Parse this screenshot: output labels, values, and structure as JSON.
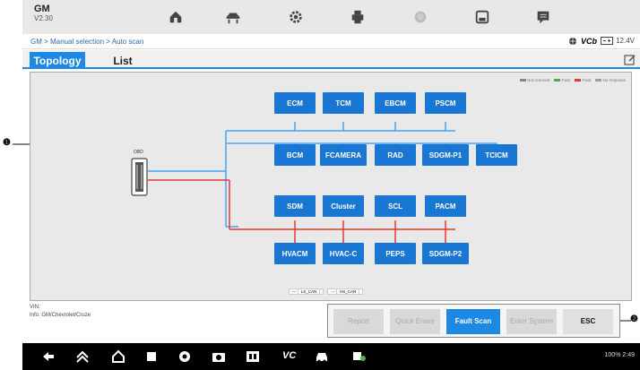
{
  "header": {
    "brand_name": "GM",
    "version": "V2.30",
    "tools": [
      "home-icon",
      "vehicle-lift-icon",
      "gear-icon",
      "printer-icon",
      "record-icon",
      "save-icon",
      "message-icon"
    ]
  },
  "breadcrumb": "GM > Manual selection > Auto scan",
  "status_bar": {
    "vci_label": "VCb",
    "voltage": "12.4V"
  },
  "tabs": [
    {
      "label": "Topology",
      "active": true
    },
    {
      "label": "List",
      "active": false
    }
  ],
  "legend": [
    {
      "label": "Not scanned",
      "color": "#7a8a9e"
    },
    {
      "label": "Pass",
      "color": "#4caf50"
    },
    {
      "label": "Fault",
      "color": "#e53935"
    },
    {
      "label": "No response",
      "color": "#9e9e9e"
    }
  ],
  "topology": {
    "obd_label": "OBD",
    "modules": [
      "ECM",
      "TCM",
      "EBCM",
      "PSCM",
      "BCM",
      "FCAMERA",
      "RAD",
      "SDGM-P1",
      "TCICM",
      "SDM",
      "Cluster",
      "SCL",
      "PACM",
      "HVACM",
      "HVAC-C",
      "PEPS",
      "SDGM-P2"
    ],
    "bus_legend": [
      {
        "label": "LS_CAN",
        "color": "#e53935"
      },
      {
        "label": "HS_CAN",
        "color": "#42a5f5"
      }
    ]
  },
  "callouts": [
    "1",
    "2"
  ],
  "vehicle_info": {
    "vin_label": "VIN:",
    "info": "Info: GM/Chevrolet/Cruze"
  },
  "actions": {
    "report": "Report",
    "quick_erase": "Quick Erase",
    "fault_scan": "Fault Scan",
    "enter_system": "Enter System",
    "esc": "ESC"
  },
  "navbar": {
    "vci_text": "VC",
    "status": "100% 2:49"
  },
  "colors": {
    "accent": "#1e88e5",
    "module": "#1976d2",
    "ls_can": "#e53935",
    "hs_can": "#42a5f5"
  }
}
